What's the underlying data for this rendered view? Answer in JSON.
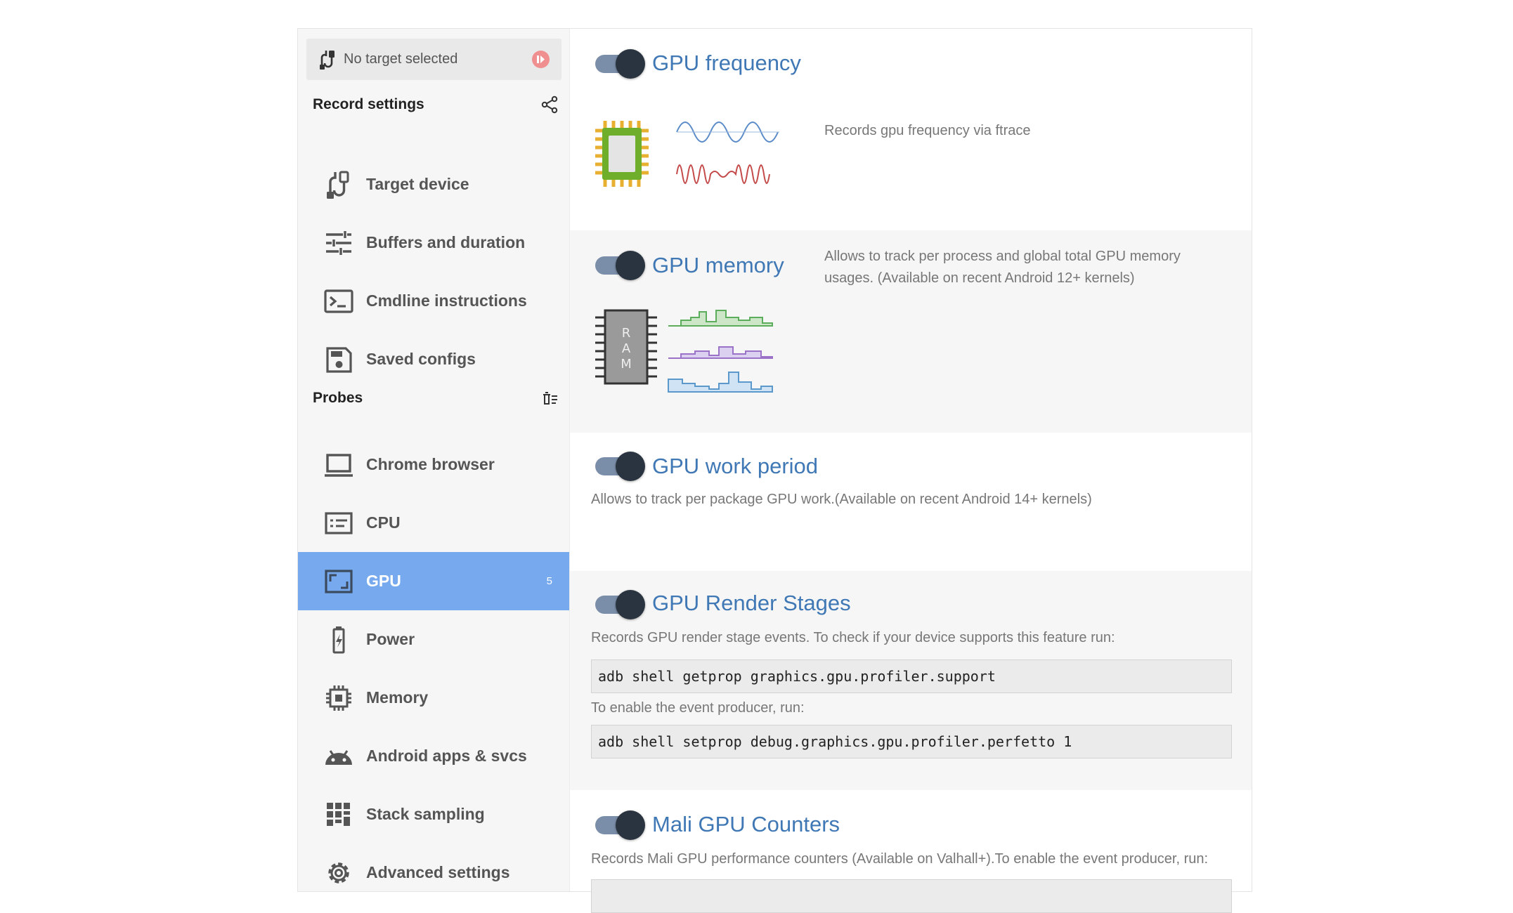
{
  "target": {
    "label": "No target selected"
  },
  "sidebar": {
    "record_settings_title": "Record settings",
    "record_items": [
      {
        "label": "Target device",
        "icon": "usb-cable-icon"
      },
      {
        "label": "Buffers and duration",
        "icon": "tune-sliders-icon"
      },
      {
        "label": "Cmdline instructions",
        "icon": "terminal-icon"
      },
      {
        "label": "Saved configs",
        "icon": "save-icon"
      }
    ],
    "probes_title": "Probes",
    "probe_items": [
      {
        "label": "Chrome browser",
        "icon": "laptop-icon"
      },
      {
        "label": "CPU",
        "icon": "cpu-list-icon"
      },
      {
        "label": "GPU",
        "icon": "gpu-screen-icon",
        "badge": "5",
        "active": true
      },
      {
        "label": "Power",
        "icon": "battery-icon"
      },
      {
        "label": "Memory",
        "icon": "memory-chip-icon"
      },
      {
        "label": "Android apps & svcs",
        "icon": "android-icon"
      },
      {
        "label": "Stack sampling",
        "icon": "stack-grid-icon"
      },
      {
        "label": "Advanced settings",
        "icon": "gear-icon"
      }
    ]
  },
  "probes": {
    "gpu_frequency": {
      "title": "GPU frequency",
      "enabled": true,
      "description": "Records gpu frequency via ftrace"
    },
    "gpu_memory": {
      "title": "GPU memory",
      "enabled": true,
      "description": "Allows to track per process and global total GPU memory usages. (Available on recent Android 12+ kernels)"
    },
    "gpu_work_period": {
      "title": "GPU work period",
      "enabled": true,
      "description": "Allows to track per package GPU work.(Available on recent Android 14+ kernels)"
    },
    "gpu_render_stages": {
      "title": "GPU Render Stages",
      "enabled": true,
      "description": "Records GPU render stage events. To check if your device supports this feature run:",
      "cmd1": "adb shell getprop graphics.gpu.profiler.support",
      "enable_text": "To enable the event producer, run:",
      "cmd2": "adb shell setprop debug.graphics.gpu.profiler.perfetto 1"
    },
    "mali_gpu_counters": {
      "title": "Mali GPU Counters",
      "enabled": true,
      "description": "Records Mali GPU performance counters (Available on Valhall+).To enable the event producer, run:"
    }
  },
  "colors": {
    "accent": "#76a9ee",
    "title_blue": "#3f78b5",
    "toggle_track": "#7b8ea9",
    "toggle_knob": "#2a3440",
    "record_red": "#ef8f8f"
  }
}
